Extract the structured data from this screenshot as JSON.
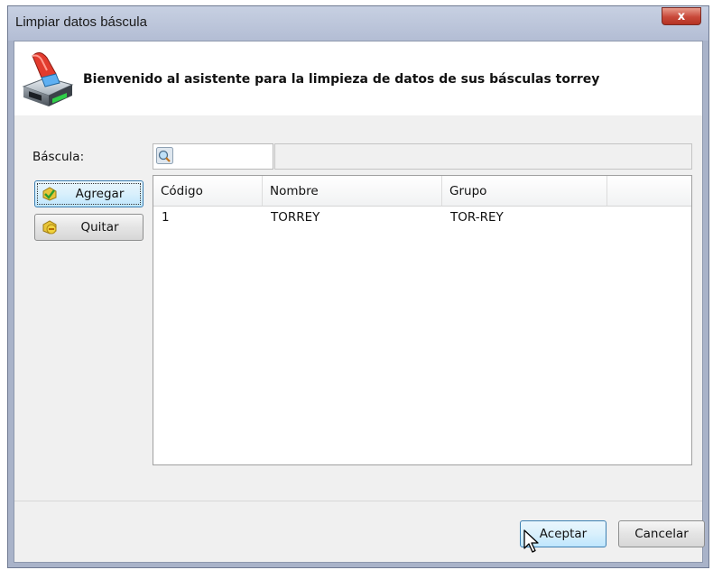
{
  "window": {
    "title": "Limpiar datos báscula",
    "close_label": "x"
  },
  "header": {
    "icon": "scale-cleaning-icon",
    "text": "Bienvenido al asistente para la limpieza de datos de sus básculas torrey"
  },
  "form": {
    "bascula_label": "Báscula:",
    "bascula_value": "",
    "picker_icon": "search-icon"
  },
  "actions": {
    "agregar_label": "Agregar",
    "quitar_label": "Quitar"
  },
  "table": {
    "columns": [
      "Código",
      "Nombre",
      "Grupo",
      ""
    ],
    "rows": [
      [
        "1",
        "TORREY",
        "TOR-REY"
      ]
    ]
  },
  "footer": {
    "aceptar_label": "Aceptar",
    "cancelar_label": "Cancelar"
  }
}
